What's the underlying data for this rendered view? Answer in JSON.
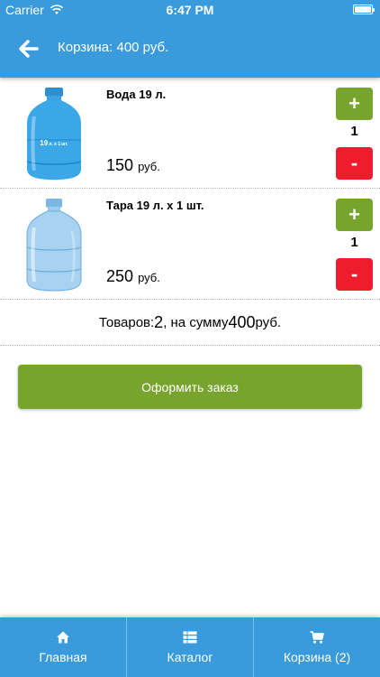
{
  "status_bar": {
    "carrier": "Carrier",
    "time": "6:47 PM"
  },
  "nav": {
    "title": "Корзина: 400 руб."
  },
  "cart": {
    "items": [
      {
        "name": "Вода 19 л.",
        "price": "150",
        "currency": "руб.",
        "quantity": "1",
        "plus_label": "+",
        "minus_label": "-",
        "label_text": "19",
        "label_sub": "л. x 1",
        "label_unit": "шт."
      },
      {
        "name": "Тара 19 л. х 1 шт.",
        "price": "250",
        "currency": "руб.",
        "quantity": "1",
        "plus_label": "+",
        "minus_label": "-"
      }
    ]
  },
  "summary": {
    "prefix": "Товаров: ",
    "count": "2",
    "middle": ", на сумму ",
    "total": "400",
    "suffix": " руб."
  },
  "checkout": {
    "label": "Оформить заказ"
  },
  "tabs": [
    {
      "label": "Главная",
      "icon": "home-icon"
    },
    {
      "label": "Каталог",
      "icon": "list-icon"
    },
    {
      "label": "Корзина (2)",
      "icon": "cart-icon"
    }
  ],
  "colors": {
    "primary": "#3a9bdc",
    "green": "#77a42c",
    "red": "#ee1c2d"
  }
}
